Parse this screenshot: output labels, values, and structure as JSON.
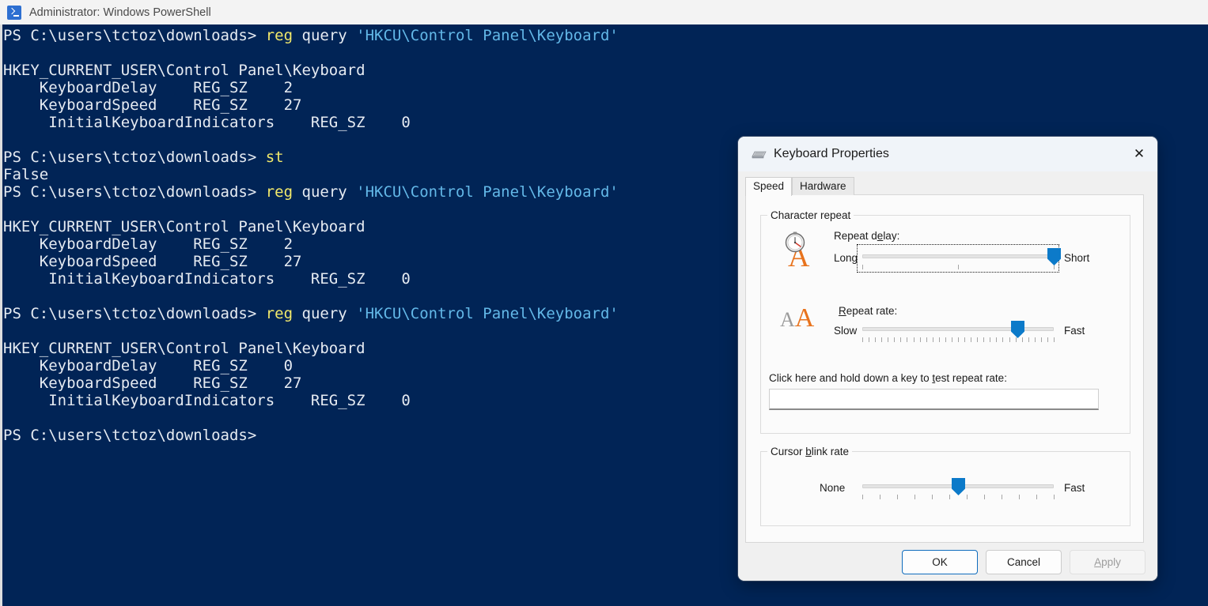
{
  "powershell": {
    "titlebar": {
      "icon": "powershell-icon",
      "title": "Administrator: Windows PowerShell"
    },
    "lines": [
      [
        {
          "t": "PS C:\\users\\tctoz\\downloads> ",
          "c": "plain"
        },
        {
          "t": "reg",
          "c": "cmd"
        },
        {
          "t": " query ",
          "c": "plain"
        },
        {
          "t": "'HKCU\\Control Panel\\Keyboard'",
          "c": "str"
        }
      ],
      [],
      [
        {
          "t": "HKEY_CURRENT_USER\\Control Panel\\Keyboard",
          "c": "plain"
        }
      ],
      [
        {
          "t": "    KeyboardDelay    REG_SZ    2",
          "c": "plain"
        }
      ],
      [
        {
          "t": "    KeyboardSpeed    REG_SZ    27",
          "c": "plain"
        }
      ],
      [
        {
          "t": "     InitialKeyboardIndicators    REG_SZ    0",
          "c": "plain"
        }
      ],
      [],
      [
        {
          "t": "PS C:\\users\\tctoz\\downloads> ",
          "c": "plain"
        },
        {
          "t": "st",
          "c": "cmd"
        }
      ],
      [
        {
          "t": "False",
          "c": "plain"
        }
      ],
      [
        {
          "t": "PS C:\\users\\tctoz\\downloads> ",
          "c": "plain"
        },
        {
          "t": "reg",
          "c": "cmd"
        },
        {
          "t": " query ",
          "c": "plain"
        },
        {
          "t": "'HKCU\\Control Panel\\Keyboard'",
          "c": "str"
        }
      ],
      [],
      [
        {
          "t": "HKEY_CURRENT_USER\\Control Panel\\Keyboard",
          "c": "plain"
        }
      ],
      [
        {
          "t": "    KeyboardDelay    REG_SZ    2",
          "c": "plain"
        }
      ],
      [
        {
          "t": "    KeyboardSpeed    REG_SZ    27",
          "c": "plain"
        }
      ],
      [
        {
          "t": "     InitialKeyboardIndicators    REG_SZ    0",
          "c": "plain"
        }
      ],
      [],
      [
        {
          "t": "PS C:\\users\\tctoz\\downloads> ",
          "c": "plain"
        },
        {
          "t": "reg",
          "c": "cmd"
        },
        {
          "t": " query ",
          "c": "plain"
        },
        {
          "t": "'HKCU\\Control Panel\\Keyboard'",
          "c": "str"
        }
      ],
      [],
      [
        {
          "t": "HKEY_CURRENT_USER\\Control Panel\\Keyboard",
          "c": "plain"
        }
      ],
      [
        {
          "t": "    KeyboardDelay    REG_SZ    0",
          "c": "plain"
        }
      ],
      [
        {
          "t": "    KeyboardSpeed    REG_SZ    27",
          "c": "plain"
        }
      ],
      [
        {
          "t": "     InitialKeyboardIndicators    REG_SZ    0",
          "c": "plain"
        }
      ],
      [],
      [
        {
          "t": "PS C:\\users\\tctoz\\downloads> ",
          "c": "plain"
        }
      ]
    ],
    "colors": {
      "background": "#012456",
      "text": "#e6ebf2",
      "command": "#f2e96b",
      "string": "#63b8e8"
    }
  },
  "dialog": {
    "icon": "keyboard-icon",
    "title": "Keyboard Properties",
    "close_label": "✕",
    "tabs": [
      {
        "label": "Speed",
        "active": true
      },
      {
        "label": "Hardware",
        "active": false
      }
    ],
    "character_repeat": {
      "legend": "Character repeat",
      "repeat_delay": {
        "label": "Repeat delay:",
        "label_prefix": "Repeat d",
        "label_accel": "e",
        "label_suffix": "lay:",
        "min_label": "Long",
        "max_label": "Short",
        "value_percent": 100,
        "ticks": 3,
        "focused": true
      },
      "repeat_rate": {
        "label": "Repeat rate:",
        "label_accel": "R",
        "label_suffix": "epeat rate:",
        "min_label": "Slow",
        "max_label": "Fast",
        "value_percent": 81,
        "ticks": 31,
        "focused": false
      },
      "test_area": {
        "label": "Click here and hold down a key to test repeat rate:",
        "label_prefix": "Click here and hold down a key to ",
        "label_accel": "t",
        "label_suffix": "est repeat rate:",
        "value": "",
        "placeholder": ""
      }
    },
    "cursor_blink_rate": {
      "legend": "Cursor blink rate",
      "legend_prefix": "Cursor ",
      "legend_accel": "b",
      "legend_suffix": "link rate",
      "min_label": "None",
      "max_label": "Fast",
      "value_percent": 50,
      "ticks": 12
    },
    "buttons": [
      {
        "label": "OK",
        "state": "default"
      },
      {
        "label": "Cancel",
        "state": "normal"
      },
      {
        "label": "Apply",
        "state": "disabled",
        "accel": "A",
        "rest": "pply"
      }
    ],
    "colors": {
      "accent": "#0c7ac9",
      "focus_border": "#0f6cbd",
      "dialog_bg": "#f0f0f0",
      "page_bg": "#fbfbfb"
    }
  }
}
